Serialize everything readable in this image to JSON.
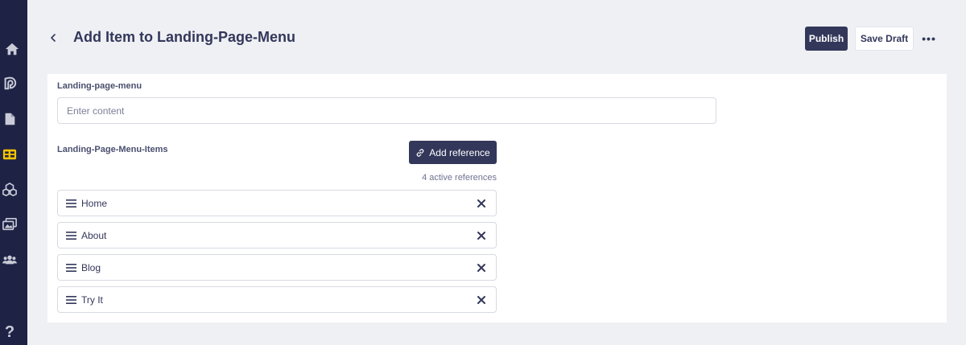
{
  "header": {
    "title": "Add Item to Landing-Page-Menu",
    "publish_label": "Publish",
    "save_draft_label": "Save Draft",
    "more_label": "•••"
  },
  "sidebar": {
    "icons": [
      "home-icon",
      "blog-icon",
      "document-icon",
      "content-icon",
      "components-icon",
      "media-icon",
      "users-icon",
      "help-icon"
    ],
    "active": "content-icon",
    "help_label": "?"
  },
  "form": {
    "menu_field": {
      "label": "Landing-page-menu",
      "value": "",
      "placeholder": "Enter content"
    },
    "items_field": {
      "label": "Landing-Page-Menu-Items",
      "add_reference_label": "Add reference",
      "active_references": "4 active references",
      "items": [
        {
          "label": "Home"
        },
        {
          "label": "About"
        },
        {
          "label": "Blog"
        },
        {
          "label": "Try It"
        }
      ]
    }
  },
  "colors": {
    "sidebar_bg": "#1e2245",
    "primary": "#33375a",
    "active_icon": "#f5c400",
    "page_bg": "#eef0f4"
  }
}
